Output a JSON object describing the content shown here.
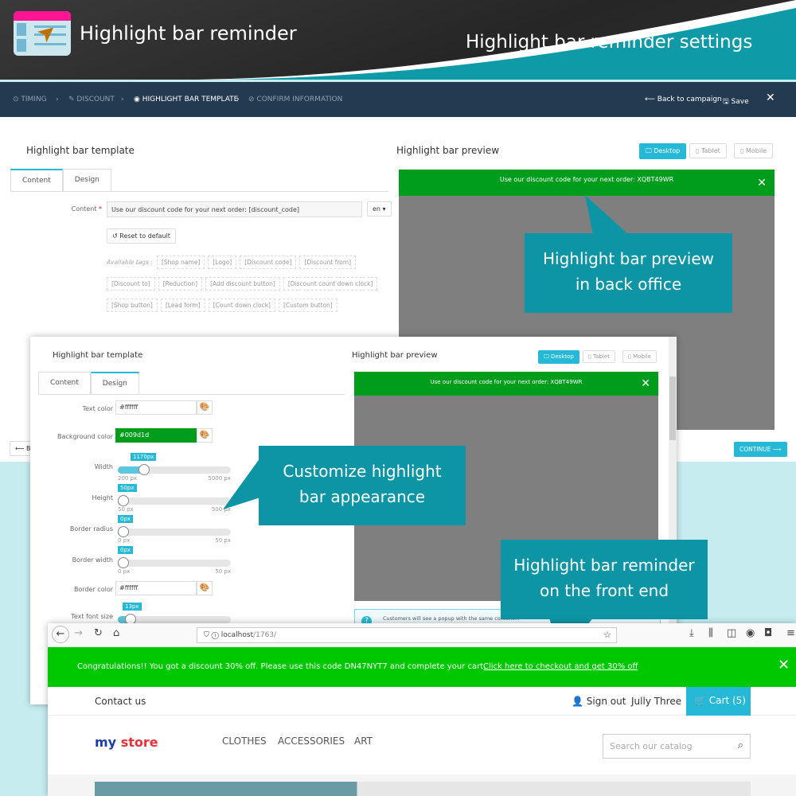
{
  "banner": {
    "title": "Highlight bar reminder",
    "subtitle": "Highlight bar reminder settings",
    "colors": {
      "dark": "#2b2b2b",
      "teal": "#0e9aa7",
      "logo_top": "#ff1493"
    }
  },
  "admin": {
    "steps": [
      "TIMING",
      "DISCOUNT",
      "HIGHLIGHT BAR TEMPLATE",
      "CONFIRM INFORMATION"
    ],
    "active_step": "HIGHLIGHT BAR TEMPLATE",
    "back_to_campaign": "Back to campaign",
    "save": "Save",
    "template_title": "Highlight bar template",
    "preview_title": "Highlight bar preview",
    "tabs": [
      "Content",
      "Design"
    ],
    "content_label": "Content",
    "required_mark": "*",
    "content_value": "Use our discount code for your next order: [discount_code]",
    "language": "en",
    "reset": "Reset to default",
    "available_tags_label": "Available tags :",
    "tags": [
      "[Shop name]",
      "[Logo]",
      "[Discount code]",
      "[Discount from]",
      "[Discount to]",
      "[Reduction]",
      "[Add discount button]",
      "[Discount count down clock]",
      "[Shop button]",
      "[Lead form]",
      "[Count down clock]",
      "[Custom button]"
    ],
    "devices": [
      "Desktop",
      "Tablet",
      "Mobile"
    ],
    "active_device": "Desktop",
    "preview_text": "Use our discount code for your next order: XQBT49WR",
    "back_button": "Back",
    "continue": "CONTINUE"
  },
  "design": {
    "text_color_label": "Text color",
    "text_color": "#ffffff",
    "bg_color_label": "Background color",
    "bg_color": "#009d1d",
    "sliders": [
      {
        "label": "Width",
        "value": "1170px",
        "min": "200 px",
        "max": "5000 px",
        "fraction": 0.2
      },
      {
        "label": "Height",
        "value": "50px",
        "min": "50 px",
        "max": "500 px",
        "fraction": 0
      },
      {
        "label": "Border radius",
        "value": "0px",
        "min": "0 px",
        "max": "50 px",
        "fraction": 0
      },
      {
        "label": "Border width",
        "value": "0px",
        "min": "0 px",
        "max": "50 px",
        "fraction": 0
      }
    ],
    "border_color_label": "Border color",
    "border_color": "#ffffff",
    "font_size_label": "Text font size",
    "font_size": "13px",
    "info_text": "Customers will see a popup with the same content..."
  },
  "callouts": [
    "Highlight bar preview",
    "in back office",
    "Customize highlight",
    "bar appearance",
    "Highlight bar reminder",
    "on the front end"
  ],
  "callout_color": "#0e95a5",
  "store": {
    "url_host": "localhost",
    "url_path": "/1763/",
    "promo_text": "Congratulations!! You got a discount 30% off. Please use this code DN47NYT7 and complete your cart.",
    "promo_link": "Click here to checkout and get 30% off",
    "promo_color": "#00c800",
    "contact": "Contact us",
    "sign_out": "Sign out",
    "user": "Jully Three",
    "cart": "Cart (5)",
    "logo_my": "my",
    "logo_store": "store",
    "menu": [
      "CLOTHES",
      "ACCESSORIES",
      "ART"
    ],
    "search_placeholder": "Search our catalog"
  }
}
